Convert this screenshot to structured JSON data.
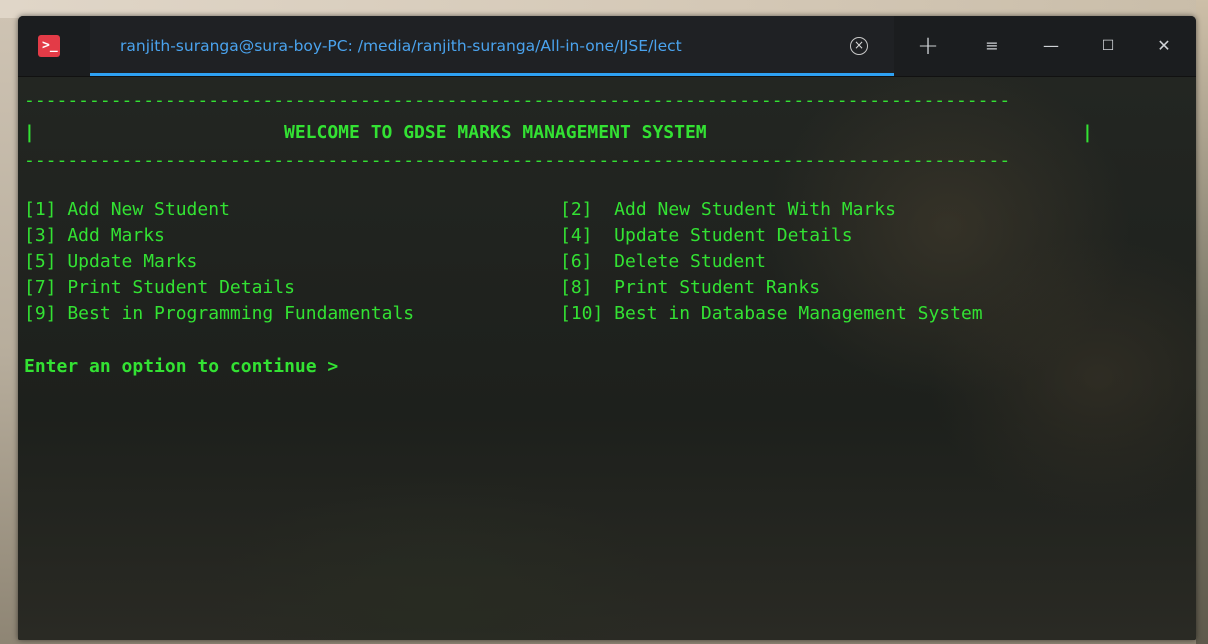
{
  "window": {
    "tab_title": "ranjith-suranga@sura-boy-PC: /media/ranjith-suranga/All-in-one/IJSE/lect",
    "tab_close_glyph": "×",
    "new_tab_glyph": "+",
    "menu_glyph": "≡",
    "minimize_glyph": "—",
    "maximize_glyph": "☐",
    "close_glyph": "✕",
    "app_icon_glyph": ">_"
  },
  "terminal": {
    "divider": "-------------------------------------------------------------------------------------------",
    "header_left": "|",
    "header_title": "WELCOME TO GDSE MARKS MANAGEMENT SYSTEM",
    "header_right": "|",
    "menu_rows": [
      [
        "[1] Add New Student",
        "[2]  Add New Student With Marks"
      ],
      [
        "[3] Add Marks",
        "[4]  Update Student Details"
      ],
      [
        "[5] Update Marks",
        "[6]  Delete Student"
      ],
      [
        "[7] Print Student Details",
        "[8]  Print Student Ranks"
      ],
      [
        "[9] Best in Programming Fundamentals",
        "[10] Best in Database Management System"
      ]
    ],
    "prompt": "Enter an option to continue >"
  },
  "colors": {
    "terminal_text": "#33e233",
    "tab_accent": "#2ea1f3",
    "app_icon": "#e33b47"
  }
}
